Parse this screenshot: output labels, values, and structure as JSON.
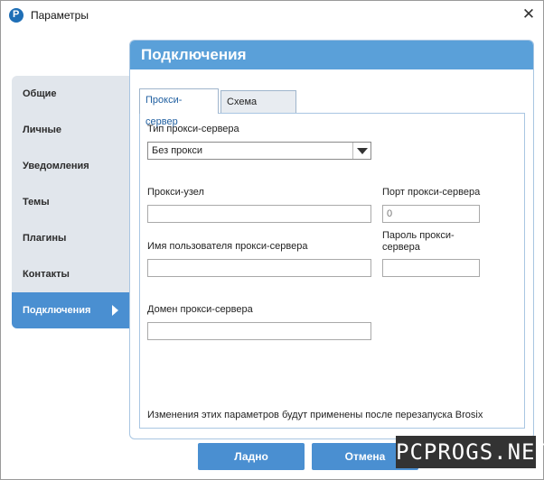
{
  "window": {
    "title": "Параметры",
    "close_glyph": "✕"
  },
  "app_icon": {
    "name": "app-logo-icon",
    "glyph": "P",
    "color": "#1f6fb6"
  },
  "sidebar": {
    "items": [
      {
        "label": "Общие"
      },
      {
        "label": "Личные"
      },
      {
        "label": "Уведомления"
      },
      {
        "label": "Темы"
      },
      {
        "label": "Плагины"
      },
      {
        "label": "Контакты"
      },
      {
        "label": "Подключения",
        "active": true
      }
    ]
  },
  "panel": {
    "title": "Подключения",
    "tabs": [
      {
        "label": "Прокси-сервер",
        "active": true
      },
      {
        "label": "Схема портов"
      }
    ]
  },
  "form": {
    "proxy_type_label": "Тип прокси-сервера",
    "proxy_type_value": "Без прокси",
    "proxy_host_label": "Прокси-узел",
    "proxy_host_value": "",
    "proxy_port_label": "Порт прокси-сервера",
    "proxy_port_value": "0",
    "username_label": "Имя пользователя прокси-сервера",
    "username_value": "",
    "password_label_line1": "Пароль прокси-",
    "password_label_line2": "сервера",
    "password_value": "",
    "domain_label": "Домен прокси-сервера",
    "domain_value": "",
    "note": "Изменения этих параметров будут применены после перезапуска Brosix"
  },
  "buttons": {
    "ok": "Ладно",
    "cancel": "Отмена"
  },
  "watermark": "PCPROGS.NET",
  "colors": {
    "accent": "#4a8fd1",
    "header": "#5aa0d9",
    "sidebar_bg": "#e1e6ec"
  }
}
